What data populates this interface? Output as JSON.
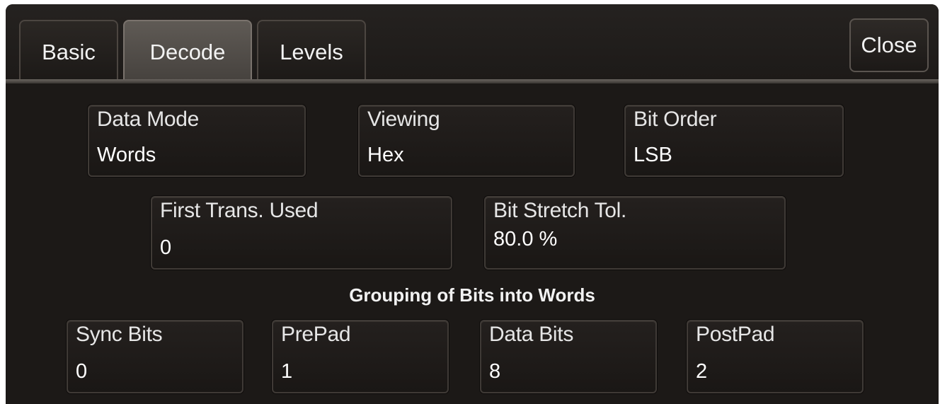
{
  "tabs": [
    {
      "label": "Basic",
      "active": false
    },
    {
      "label": "Decode",
      "active": true
    },
    {
      "label": "Levels",
      "active": false
    }
  ],
  "close_label": "Close",
  "fields": {
    "data_mode": {
      "label": "Data Mode",
      "value": "Words"
    },
    "viewing": {
      "label": "Viewing",
      "value": "Hex"
    },
    "bit_order": {
      "label": "Bit Order",
      "value": "LSB"
    },
    "first_trans": {
      "label": "First Trans. Used",
      "value": "0"
    },
    "bit_stretch": {
      "label": "Bit Stretch Tol.",
      "value": "80.0 %"
    }
  },
  "grouping": {
    "title": "Grouping of Bits into Words",
    "sync_bits": {
      "label": "Sync Bits",
      "value": "0"
    },
    "prepad": {
      "label": "PrePad",
      "value": "1"
    },
    "data_bits": {
      "label": "Data Bits",
      "value": "8"
    },
    "postpad": {
      "label": "PostPad",
      "value": "2"
    }
  },
  "colors": {
    "background": "#1b1816",
    "active_tab": "#5f5a55",
    "text": "#f2f2f2"
  }
}
